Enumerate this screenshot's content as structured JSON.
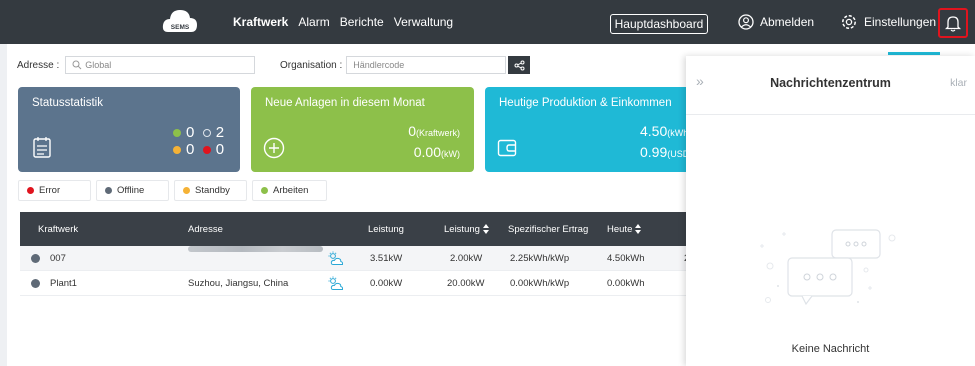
{
  "topbar": {
    "logo_text": "SEMS",
    "nav": [
      "Kraftwerk",
      "Alarm",
      "Berichte",
      "Verwaltung"
    ],
    "active_nav": "Kraftwerk",
    "dashboard_btn": "Hauptdashboard",
    "logout": "Abmelden",
    "settings": "Einstellungen"
  },
  "filters": {
    "address_label": "Adresse :",
    "address_placeholder": "Global",
    "org_label": "Organisation :",
    "org_placeholder": "Händlercode"
  },
  "cards": {
    "status": {
      "title": "Statusstatistik",
      "green": "0",
      "gray": "2",
      "orange": "0",
      "red": "0",
      "color": "#5c748d"
    },
    "new_plants": {
      "title": "Neue Anlagen in diesem Monat",
      "value1": "0",
      "unit1": "(Kraftwerk)",
      "value2": "0.00",
      "unit2": "(kW)",
      "color": "#8dc04a"
    },
    "production": {
      "title": "Heutige Produktion & Einkommen",
      "value1": "4.50",
      "unit1": "(kWh)",
      "value2": "0.99",
      "unit2": "(USD)",
      "color": "#1fb9d6"
    }
  },
  "legend": {
    "error": "Error",
    "offline": "Offline",
    "standby": "Standby",
    "working": "Arbeiten",
    "colors": {
      "error": "#e0141e",
      "offline": "#5f6a77",
      "standby": "#f5b236",
      "working": "#8dc04a"
    }
  },
  "table": {
    "headers": {
      "plant": "Kraftwerk",
      "address": "Adresse",
      "power": "Leistung",
      "capacity": "Leistung",
      "yield": "Spezifischer Ertrag",
      "today": "Heute"
    },
    "rows": [
      {
        "plant": "007",
        "address": "",
        "power": "3.51kW",
        "capacity": "2.00kW",
        "yield": "2.25kWh/kWp",
        "today": "4.50kWh",
        "extra": "2"
      },
      {
        "plant": "Plant1",
        "address": "Suzhou, Jiangsu, China",
        "power": "0.00kW",
        "capacity": "20.00kW",
        "yield": "0.00kWh/kWp",
        "today": "0.00kWh",
        "extra": ""
      }
    ]
  },
  "panel": {
    "title": "Nachrichtenzentrum",
    "clear": "klar",
    "empty": "Keine Nachricht"
  }
}
